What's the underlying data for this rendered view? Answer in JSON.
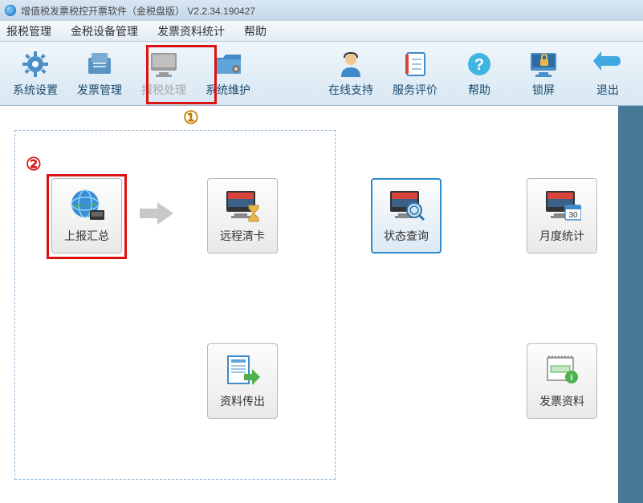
{
  "title": "增值税发票税控开票软件（金税盘版） V2.2.34.190427",
  "menu": {
    "m1": "报税管理",
    "m2": "金税设备管理",
    "m3": "发票资料统计",
    "m4": "帮助"
  },
  "toolbar": {
    "sys_settings": "系统设置",
    "invoice_mgmt": "发票管理",
    "tax_process": "报税处理",
    "sys_maint": "系统维护",
    "online_support": "在线支持",
    "service_rating": "服务评价",
    "help": "帮助",
    "lock": "锁屏",
    "exit": "退出"
  },
  "panel": {
    "report_summary": "上报汇总",
    "remote_clear": "远程清卡",
    "data_export": "资料传出",
    "status_query": "状态查询",
    "monthly_stats": "月度统计",
    "invoice_data": "发票资料"
  },
  "annot": {
    "one": "①",
    "two": "②"
  },
  "monthly_badge": "30"
}
